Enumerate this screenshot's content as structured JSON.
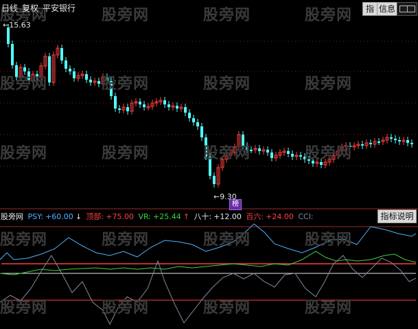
{
  "header": {
    "period": "日线",
    "adjust": "复权",
    "stock_name": "平安银行"
  },
  "toolbar": {
    "indicator_btn": "指",
    "info_btn": "信息"
  },
  "price_panel": {
    "high_label": "15.63",
    "low_label": "9.30",
    "badge": "榜"
  },
  "indicator_panel": {
    "name": "股旁网",
    "psy_name": "PSY:",
    "psy_value": "+60.00",
    "psy_arrow": "↓",
    "top_name": "顶部:",
    "top_value": "+75.00",
    "vr_name": "VR:",
    "vr_value": "+25.44",
    "vr_arrow": "↑",
    "eighty_name": "八十:",
    "eighty_value": "+12.00",
    "bai_name": "百六:",
    "bai_value": "+24.00",
    "cci_name": "CCI:",
    "explain_btn": "指标说明"
  },
  "watermark": "股旁网",
  "colors": {
    "up": "#ff4040",
    "down": "#54ffff",
    "psy": "#4fb3ff",
    "vr": "#3fd23f",
    "cci": "#7f8da0",
    "level": "#ff3c3c",
    "white_line": "#e8e8e8",
    "grid": "#8a1e1e"
  }
}
